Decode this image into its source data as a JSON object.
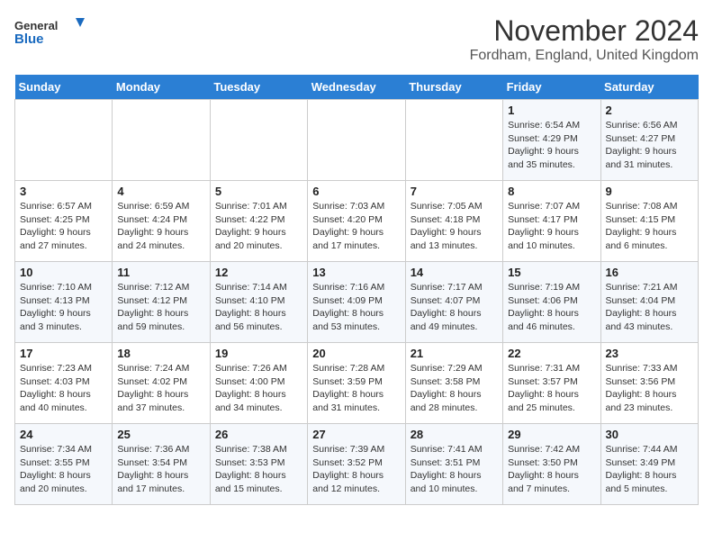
{
  "header": {
    "logo_line1": "General",
    "logo_line2": "Blue",
    "month_title": "November 2024",
    "location": "Fordham, England, United Kingdom"
  },
  "weekdays": [
    "Sunday",
    "Monday",
    "Tuesday",
    "Wednesday",
    "Thursday",
    "Friday",
    "Saturday"
  ],
  "weeks": [
    [
      {
        "day": "",
        "info": ""
      },
      {
        "day": "",
        "info": ""
      },
      {
        "day": "",
        "info": ""
      },
      {
        "day": "",
        "info": ""
      },
      {
        "day": "",
        "info": ""
      },
      {
        "day": "1",
        "info": "Sunrise: 6:54 AM\nSunset: 4:29 PM\nDaylight: 9 hours and 35 minutes."
      },
      {
        "day": "2",
        "info": "Sunrise: 6:56 AM\nSunset: 4:27 PM\nDaylight: 9 hours and 31 minutes."
      }
    ],
    [
      {
        "day": "3",
        "info": "Sunrise: 6:57 AM\nSunset: 4:25 PM\nDaylight: 9 hours and 27 minutes."
      },
      {
        "day": "4",
        "info": "Sunrise: 6:59 AM\nSunset: 4:24 PM\nDaylight: 9 hours and 24 minutes."
      },
      {
        "day": "5",
        "info": "Sunrise: 7:01 AM\nSunset: 4:22 PM\nDaylight: 9 hours and 20 minutes."
      },
      {
        "day": "6",
        "info": "Sunrise: 7:03 AM\nSunset: 4:20 PM\nDaylight: 9 hours and 17 minutes."
      },
      {
        "day": "7",
        "info": "Sunrise: 7:05 AM\nSunset: 4:18 PM\nDaylight: 9 hours and 13 minutes."
      },
      {
        "day": "8",
        "info": "Sunrise: 7:07 AM\nSunset: 4:17 PM\nDaylight: 9 hours and 10 minutes."
      },
      {
        "day": "9",
        "info": "Sunrise: 7:08 AM\nSunset: 4:15 PM\nDaylight: 9 hours and 6 minutes."
      }
    ],
    [
      {
        "day": "10",
        "info": "Sunrise: 7:10 AM\nSunset: 4:13 PM\nDaylight: 9 hours and 3 minutes."
      },
      {
        "day": "11",
        "info": "Sunrise: 7:12 AM\nSunset: 4:12 PM\nDaylight: 8 hours and 59 minutes."
      },
      {
        "day": "12",
        "info": "Sunrise: 7:14 AM\nSunset: 4:10 PM\nDaylight: 8 hours and 56 minutes."
      },
      {
        "day": "13",
        "info": "Sunrise: 7:16 AM\nSunset: 4:09 PM\nDaylight: 8 hours and 53 minutes."
      },
      {
        "day": "14",
        "info": "Sunrise: 7:17 AM\nSunset: 4:07 PM\nDaylight: 8 hours and 49 minutes."
      },
      {
        "day": "15",
        "info": "Sunrise: 7:19 AM\nSunset: 4:06 PM\nDaylight: 8 hours and 46 minutes."
      },
      {
        "day": "16",
        "info": "Sunrise: 7:21 AM\nSunset: 4:04 PM\nDaylight: 8 hours and 43 minutes."
      }
    ],
    [
      {
        "day": "17",
        "info": "Sunrise: 7:23 AM\nSunset: 4:03 PM\nDaylight: 8 hours and 40 minutes."
      },
      {
        "day": "18",
        "info": "Sunrise: 7:24 AM\nSunset: 4:02 PM\nDaylight: 8 hours and 37 minutes."
      },
      {
        "day": "19",
        "info": "Sunrise: 7:26 AM\nSunset: 4:00 PM\nDaylight: 8 hours and 34 minutes."
      },
      {
        "day": "20",
        "info": "Sunrise: 7:28 AM\nSunset: 3:59 PM\nDaylight: 8 hours and 31 minutes."
      },
      {
        "day": "21",
        "info": "Sunrise: 7:29 AM\nSunset: 3:58 PM\nDaylight: 8 hours and 28 minutes."
      },
      {
        "day": "22",
        "info": "Sunrise: 7:31 AM\nSunset: 3:57 PM\nDaylight: 8 hours and 25 minutes."
      },
      {
        "day": "23",
        "info": "Sunrise: 7:33 AM\nSunset: 3:56 PM\nDaylight: 8 hours and 23 minutes."
      }
    ],
    [
      {
        "day": "24",
        "info": "Sunrise: 7:34 AM\nSunset: 3:55 PM\nDaylight: 8 hours and 20 minutes."
      },
      {
        "day": "25",
        "info": "Sunrise: 7:36 AM\nSunset: 3:54 PM\nDaylight: 8 hours and 17 minutes."
      },
      {
        "day": "26",
        "info": "Sunrise: 7:38 AM\nSunset: 3:53 PM\nDaylight: 8 hours and 15 minutes."
      },
      {
        "day": "27",
        "info": "Sunrise: 7:39 AM\nSunset: 3:52 PM\nDaylight: 8 hours and 12 minutes."
      },
      {
        "day": "28",
        "info": "Sunrise: 7:41 AM\nSunset: 3:51 PM\nDaylight: 8 hours and 10 minutes."
      },
      {
        "day": "29",
        "info": "Sunrise: 7:42 AM\nSunset: 3:50 PM\nDaylight: 8 hours and 7 minutes."
      },
      {
        "day": "30",
        "info": "Sunrise: 7:44 AM\nSunset: 3:49 PM\nDaylight: 8 hours and 5 minutes."
      }
    ]
  ]
}
